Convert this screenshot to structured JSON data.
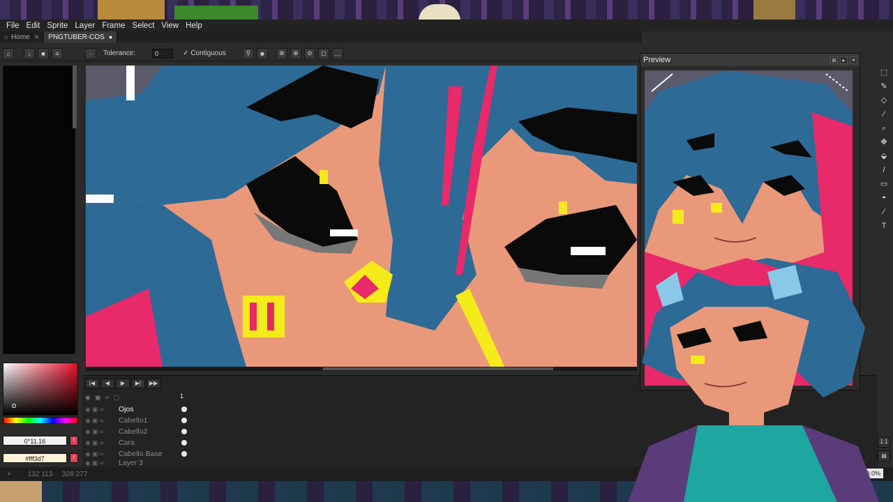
{
  "menu": [
    "File",
    "Edit",
    "Sprite",
    "Layer",
    "Frame",
    "Select",
    "View",
    "Help"
  ],
  "tabs": [
    {
      "label": "Home",
      "active": false
    },
    {
      "label": "PNGTUBER-COS",
      "active": true
    }
  ],
  "toolbar": {
    "tolerance_label": "Tolerance:",
    "tolerance_value": "0",
    "contiguous_label": "Contiguous"
  },
  "colors": {
    "foreground": "0°11.16",
    "background": "#fff3d7"
  },
  "preview": {
    "title": "Preview"
  },
  "timeline": {
    "frame_number": "1",
    "layers": [
      {
        "name": "Ojos",
        "active": true
      },
      {
        "name": "Cabello1",
        "active": false
      },
      {
        "name": "Cabello2",
        "active": false
      },
      {
        "name": "Cara",
        "active": false
      },
      {
        "name": "Cabello Base",
        "active": false
      },
      {
        "name": "Layer 3",
        "active": false
      }
    ]
  },
  "status": {
    "cursor_pos": "132 113",
    "size": "328 277",
    "zoom": "00.0%"
  },
  "palette_colors": {
    "hair_blue": "#2e6a96",
    "hair_dark": "#224e74",
    "skin": "#e9997a",
    "pink": "#e8296a",
    "yellow": "#f5ea1a",
    "black": "#0a0a0a"
  }
}
